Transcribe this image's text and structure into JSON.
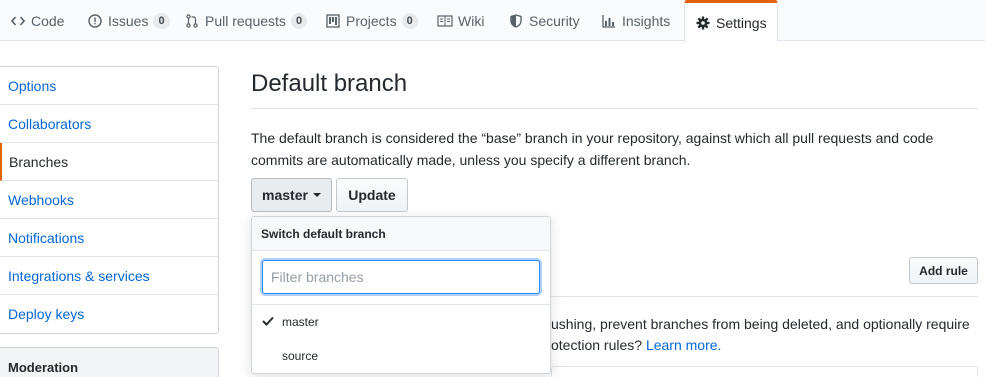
{
  "nav": {
    "tabs": [
      {
        "label": "Code",
        "icon": "code-icon"
      },
      {
        "label": "Issues",
        "icon": "issue-opened-icon",
        "count": "0"
      },
      {
        "label": "Pull requests",
        "icon": "git-pull-request-icon",
        "count": "0"
      },
      {
        "label": "Projects",
        "icon": "project-icon",
        "count": "0"
      },
      {
        "label": "Wiki",
        "icon": "book-icon"
      },
      {
        "label": "Security",
        "icon": "shield-icon"
      },
      {
        "label": "Insights",
        "icon": "graph-icon"
      },
      {
        "label": "Settings",
        "icon": "gear-icon",
        "selected": true
      }
    ],
    "accent_color": "#e36209"
  },
  "sidebar": {
    "items": [
      {
        "label": "Options"
      },
      {
        "label": "Collaborators"
      },
      {
        "label": "Branches",
        "selected": true
      },
      {
        "label": "Webhooks"
      },
      {
        "label": "Notifications"
      },
      {
        "label": "Integrations & services"
      },
      {
        "label": "Deploy keys"
      }
    ],
    "moderation_header": "Moderation"
  },
  "main": {
    "title": "Default branch",
    "description": "The default branch is considered the “base” branch in your repository, against which all pull requests and code commits are automatically made, unless you specify a different branch.",
    "branch_button": "master",
    "update_button": "Update",
    "add_rule_button": "Add rule",
    "protection_text_1": "ushing, prevent branches from being deleted, and optionally require",
    "protection_text_2": "otection rules?",
    "learn_more_link": "Learn more."
  },
  "dropdown": {
    "header": "Switch default branch",
    "filter_placeholder": "Filter branches",
    "filter_value": "",
    "items": [
      {
        "label": "master",
        "checked": true
      },
      {
        "label": "source",
        "checked": false
      }
    ]
  },
  "colors": {
    "link": "#0366d6",
    "text": "#24292e",
    "muted": "#586069",
    "focus": "#2188ff"
  }
}
